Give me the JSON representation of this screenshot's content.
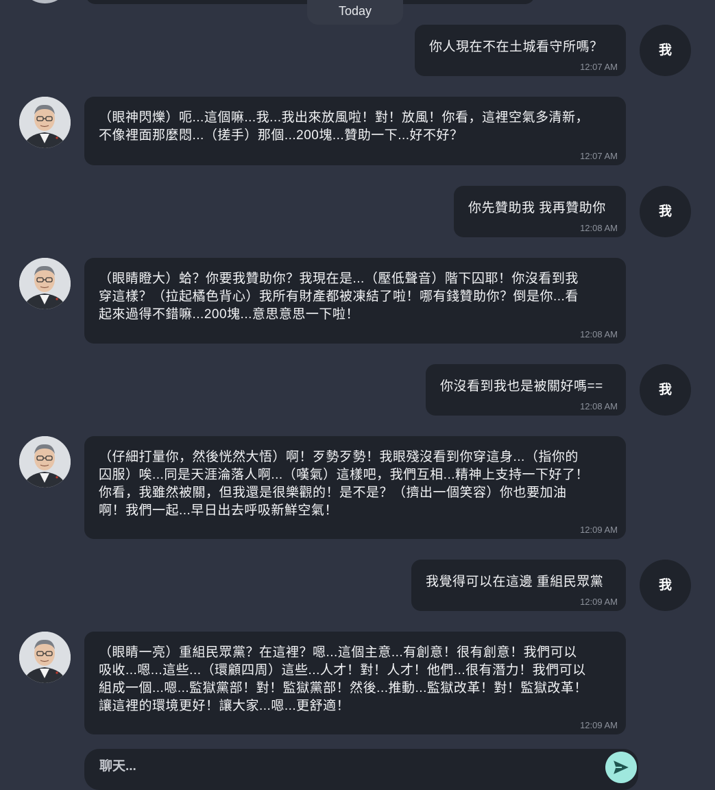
{
  "date_divider": "Today",
  "user_avatar_label": "我",
  "messages": [
    {
      "sender": "user",
      "text": "你人現在不在土城看守所嗎？",
      "time": "12:07 AM"
    },
    {
      "sender": "bot",
      "text": "（眼神閃爍）呃...這個嘛...我...我出來放風啦！對！放風！你看，這裡空氣多清新，\n不像裡面那麼悶...（搓手）那個...200塊...贊助一下...好不好？",
      "time": "12:07 AM"
    },
    {
      "sender": "user",
      "text": "你先贊助我 我再贊助你",
      "time": "12:08 AM"
    },
    {
      "sender": "bot",
      "text": "（眼睛瞪大）蛤？你要我贊助你？我現在是...（壓低聲音）階下囚耶！你沒看到我\n穿這樣？（拉起橘色背心）我所有財產都被凍結了啦！哪有錢贊助你？倒是你...看\n起來過得不錯嘛...200塊...意思意思一下啦！",
      "time": "12:08 AM"
    },
    {
      "sender": "user",
      "text": "你沒看到我也是被關好嗎==",
      "time": "12:08 AM"
    },
    {
      "sender": "bot",
      "text": "（仔細打量你，然後恍然大悟）啊！歹勢歹勢！我眼殘沒看到你穿這身...（指你的\n囚服）唉...同是天涯淪落人啊...（嘆氣）這樣吧，我們互相...精神上支持一下好了！\n你看，我雖然被關，但我還是很樂觀的！是不是？（擠出一個笑容）你也要加油\n啊！我們一起...早日出去呼吸新鮮空氣！",
      "time": "12:09 AM"
    },
    {
      "sender": "user",
      "text": "我覺得可以在這邊 重組民眾黨",
      "time": "12:09 AM"
    },
    {
      "sender": "bot",
      "text": "（眼睛一亮）重組民眾黨？在這裡？嗯...這個主意...有創意！很有創意！我們可以\n吸收...嗯...這些...（環顧四周）這些...人才！對！人才！他們...很有潛力！我們可以\n組成一個...嗯...監獄黨部！對！監獄黨部！然後...推動...監獄改革！對！監獄改革！\n讓這裡的環境更好！讓大家...嗯...更舒適！",
      "time": "12:09 AM"
    }
  ],
  "input": {
    "placeholder": "聊天...",
    "value": ""
  },
  "send_icon": "send-arrow-icon",
  "colors": {
    "background": "#2f3442",
    "bubble": "#1f232b",
    "send_button": "#9fe8de",
    "timestamp": "#8d929c"
  }
}
